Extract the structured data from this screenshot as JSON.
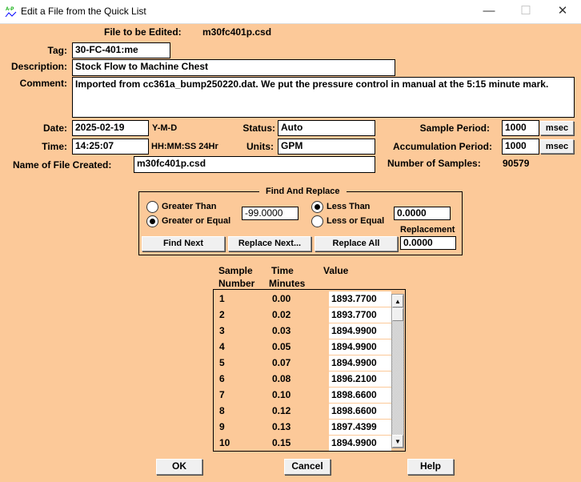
{
  "window": {
    "title": "Edit a File from the Quick List",
    "minimize": "—",
    "maximize": "☐",
    "close": "✕"
  },
  "file_to_edit": {
    "label": "File to be Edited:",
    "value": "m30fc401p.csd"
  },
  "tag": {
    "label": "Tag:",
    "value": "30-FC-401:me"
  },
  "description": {
    "label": "Description:",
    "value": "Stock Flow to Machine Chest"
  },
  "comment": {
    "label": "Comment:",
    "value": "Imported from cc361a_bump250220.dat. We put the pressure control in manual at the 5:15 minute mark."
  },
  "date": {
    "label": "Date:",
    "value": "2025-02-19",
    "hint": "Y-M-D"
  },
  "time": {
    "label": "Time:",
    "value": "14:25:07",
    "hint": "HH:MM:SS 24Hr"
  },
  "status": {
    "label": "Status:",
    "value": "Auto"
  },
  "units": {
    "label": "Units:",
    "value": "GPM"
  },
  "sample_period": {
    "label": "Sample Period:",
    "value": "1000",
    "unit": "msec"
  },
  "accumulation_period": {
    "label": "Accumulation Period:",
    "value": "1000",
    "unit": "msec"
  },
  "file_created": {
    "label": "Name of File Created:",
    "value": "m30fc401p.csd"
  },
  "num_samples": {
    "label": "Number of Samples:",
    "value": "90579"
  },
  "find_replace": {
    "title": "Find And Replace",
    "greater_than": "Greater Than",
    "greater_equal": "Greater or Equal",
    "lower_value": "-99.0000",
    "less_than": "Less Than",
    "less_equal": "Less or Equal",
    "upper_value": "0.0000",
    "replacement_label": "Replacement",
    "replacement_value": "0.0000",
    "find_next": "Find Next",
    "replace_next": "Replace Next...",
    "replace_all": "Replace All"
  },
  "table": {
    "headers": {
      "sample1": "Sample",
      "sample2": "Number",
      "time1": "Time",
      "time2": "Minutes",
      "value": "Value"
    },
    "rows": [
      {
        "n": "1",
        "t": "0.00",
        "v": "1893.7700"
      },
      {
        "n": "2",
        "t": "0.02",
        "v": "1893.7700"
      },
      {
        "n": "3",
        "t": "0.03",
        "v": "1894.9900"
      },
      {
        "n": "4",
        "t": "0.05",
        "v": "1894.9900"
      },
      {
        "n": "5",
        "t": "0.07",
        "v": "1894.9900"
      },
      {
        "n": "6",
        "t": "0.08",
        "v": "1896.2100"
      },
      {
        "n": "7",
        "t": "0.10",
        "v": "1898.6600"
      },
      {
        "n": "8",
        "t": "0.12",
        "v": "1898.6600"
      },
      {
        "n": "9",
        "t": "0.13",
        "v": "1897.4399"
      },
      {
        "n": "10",
        "t": "0.15",
        "v": "1894.9900"
      }
    ]
  },
  "buttons": {
    "ok": "OK",
    "cancel": "Cancel",
    "help": "Help"
  }
}
